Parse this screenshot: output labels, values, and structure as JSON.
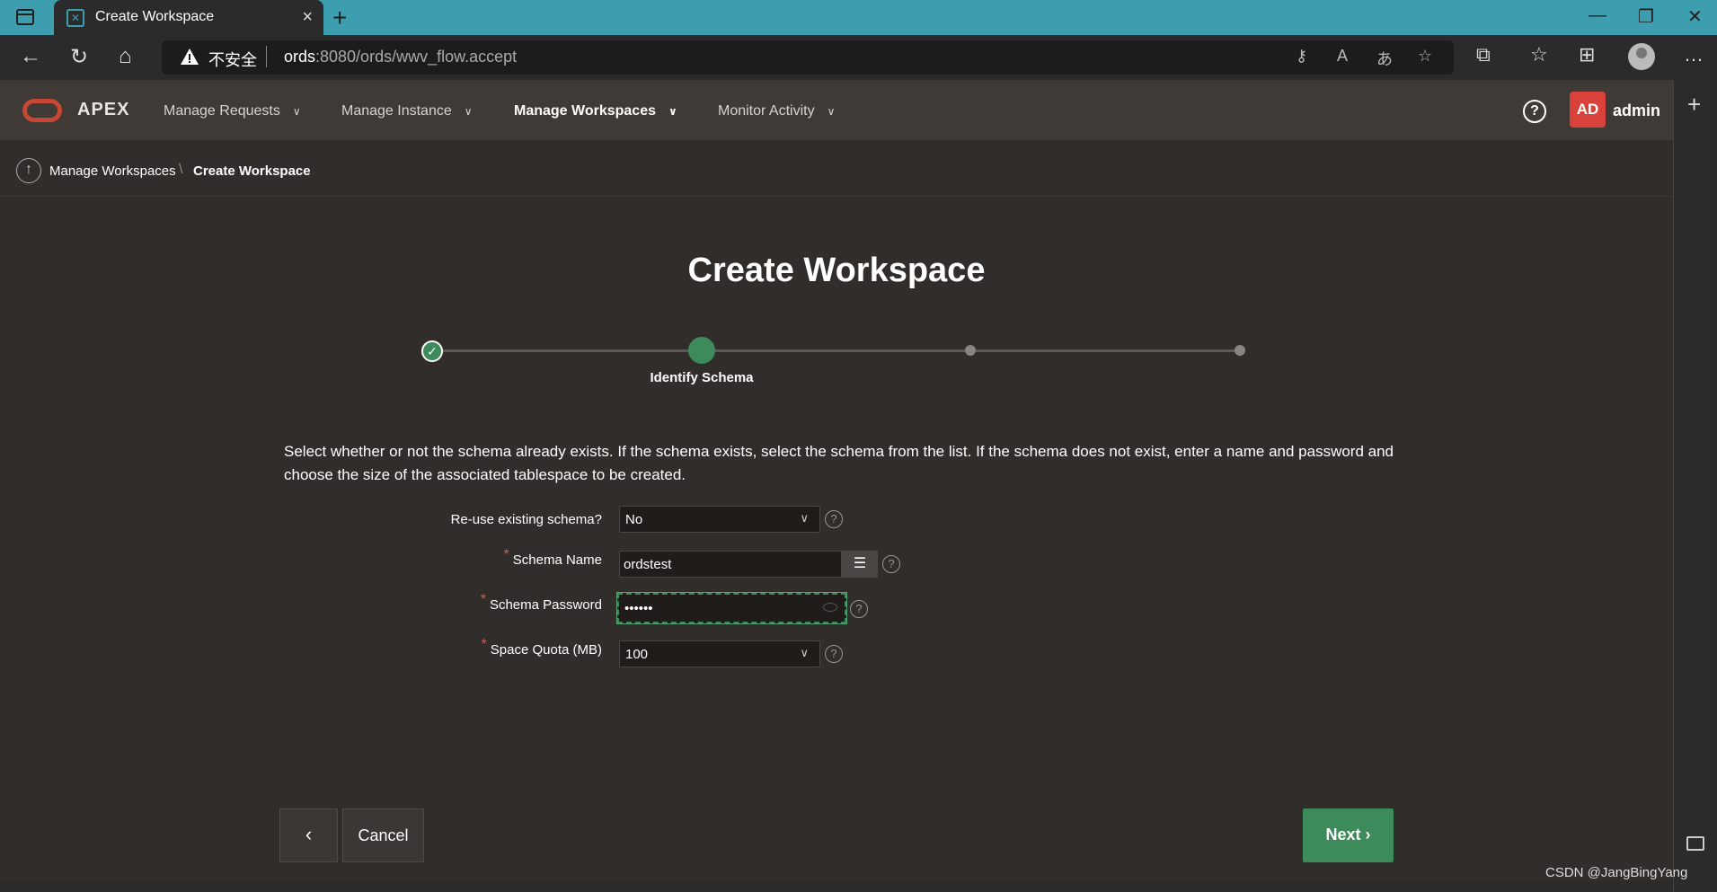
{
  "browser": {
    "tab_title": "Create Workspace",
    "new_tab": "+",
    "insecure_label": "不安全",
    "url_host": "ords",
    "url_rest": ":8080/ords/wwv_flow.accept"
  },
  "header": {
    "product": "APEX",
    "menu": [
      {
        "label": "Manage Requests"
      },
      {
        "label": "Manage Instance"
      },
      {
        "label": "Manage Workspaces"
      },
      {
        "label": "Monitor Activity"
      }
    ],
    "avatar_initials": "AD",
    "username": "admin"
  },
  "breadcrumb": {
    "parent": "Manage Workspaces",
    "current": "Create Workspace"
  },
  "page": {
    "title": "Create Workspace",
    "current_step_label": "Identify Schema",
    "description": "Select whether or not the schema already exists. If the schema exists, select the schema from the list. If the schema does not exist, enter a name and password and choose the size of the associated tablespace to be created."
  },
  "form": {
    "reuse_label": "Re-use existing schema?",
    "reuse_value": "No",
    "schema_name_label": "Schema Name",
    "schema_name_value": "ordstest",
    "schema_password_label": "Schema Password",
    "schema_password_value": "••••••",
    "quota_label": "Space Quota (MB)",
    "quota_value": "100",
    "required_mark": "*",
    "help_glyph": "?"
  },
  "buttons": {
    "back": "‹",
    "cancel": "Cancel",
    "next": "Next ›"
  },
  "watermark": "CSDN @JangBingYang"
}
